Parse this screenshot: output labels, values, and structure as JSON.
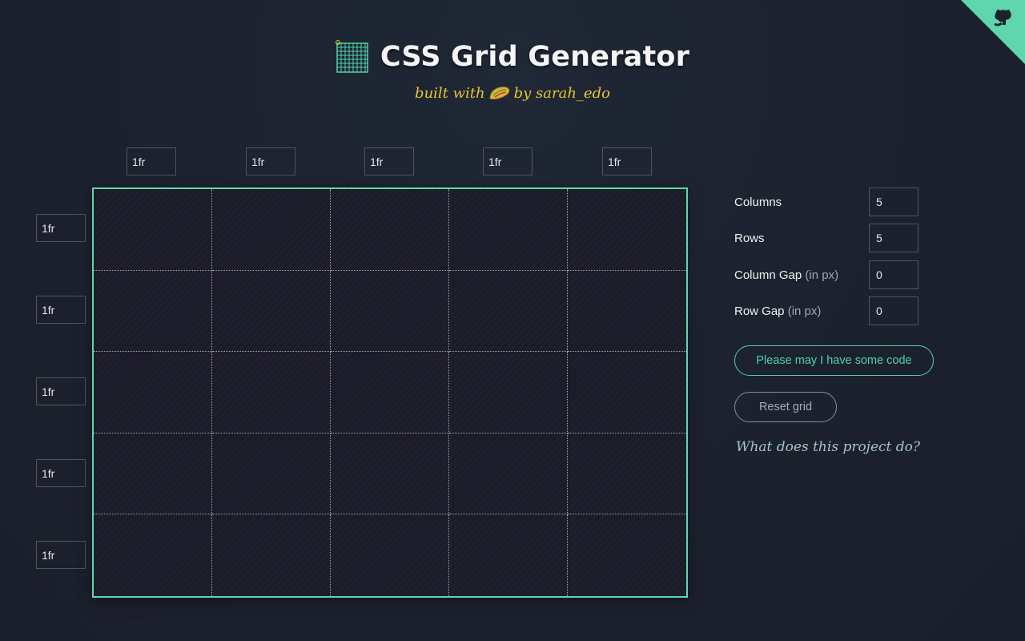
{
  "header": {
    "title": "CSS Grid Generator",
    "subtitle_prefix": "built with",
    "subtitle_suffix": "by sarah_edo",
    "logo_icon": "grid-icon",
    "taco_icon": "taco-icon"
  },
  "corner": {
    "icon": "github-octocat-icon"
  },
  "columns_track": [
    "1fr",
    "1fr",
    "1fr",
    "1fr",
    "1fr"
  ],
  "rows_track": [
    "1fr",
    "1fr",
    "1fr",
    "1fr",
    "1fr"
  ],
  "controls": {
    "columns": {
      "label": "Columns",
      "value": "5"
    },
    "rows": {
      "label": "Rows",
      "value": "5"
    },
    "column_gap": {
      "label": "Column Gap",
      "hint": "(in px)",
      "value": "0"
    },
    "row_gap": {
      "label": "Row Gap",
      "hint": "(in px)",
      "value": "0"
    }
  },
  "buttons": {
    "code": "Please may I have some code",
    "reset": "Reset grid"
  },
  "about_link": "What does this project do?",
  "colors": {
    "accent": "#4ed3a8",
    "subtitle": "#e7c62b",
    "background": "#1d2230"
  }
}
